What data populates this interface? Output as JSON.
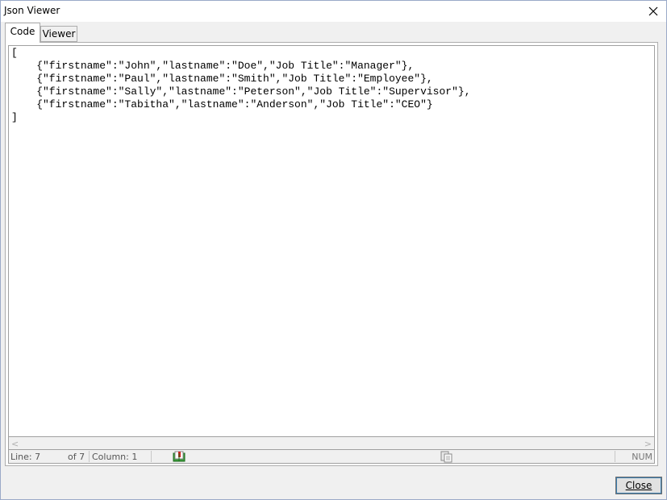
{
  "window": {
    "title": "Json Viewer"
  },
  "tabs": [
    {
      "label": "Code",
      "active": true
    },
    {
      "label": "Viewer",
      "active": false
    }
  ],
  "editor": {
    "lines": [
      "[",
      "    {\"firstname\":\"John\",\"lastname\":\"Doe\",\"Job Title\":\"Manager\"},",
      "    {\"firstname\":\"Paul\",\"lastname\":\"Smith\",\"Job Title\":\"Employee\"},",
      "    {\"firstname\":\"Sally\",\"lastname\":\"Peterson\",\"Job Title\":\"Supervisor\"},",
      "    {\"firstname\":\"Tabitha\",\"lastname\":\"Anderson\",\"Job Title\":\"CEO\"}",
      "]"
    ]
  },
  "status": {
    "line": "Line: 7",
    "of": "of 7",
    "column": "Column: 1",
    "num": "NUM"
  },
  "buttons": {
    "close": "Close"
  },
  "icons": {
    "close": "close-icon",
    "book": "book-icon",
    "copy": "copy-icon"
  }
}
